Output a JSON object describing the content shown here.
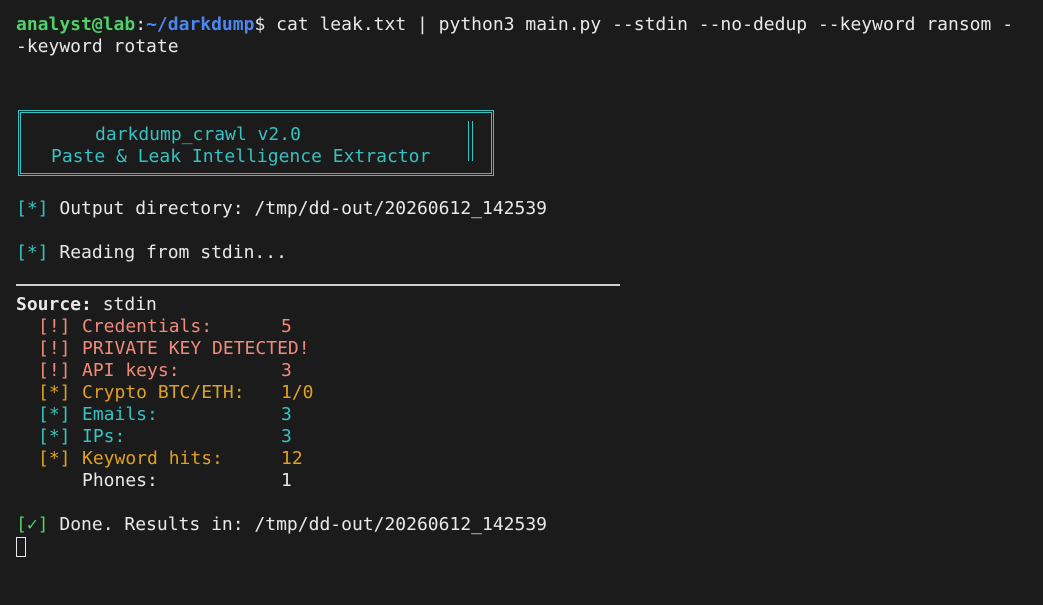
{
  "prompt": {
    "user_host": "analyst@lab",
    "separator": ":",
    "path": "~/darkdump",
    "symbol": "$",
    "command_line1": " cat leak.txt | python3 main.py --stdin --no-dedup --keyword ransom -",
    "command_line2": "-keyword rotate"
  },
  "banner": {
    "title": "darkdump_crawl v2.0",
    "subtitle": "Paste & Leak Intelligence Extractor"
  },
  "messages": {
    "output_dir_tag": "[*]",
    "output_dir": " Output directory: /tmp/dd-out/20260612_142539",
    "reading_tag": "[*]",
    "reading": " Reading from stdin..."
  },
  "source": {
    "label": "Source:",
    "value": " stdin"
  },
  "stats": [
    {
      "tag": "[!]",
      "label": "Credentials:",
      "value": "5",
      "color": "#f08a7a"
    },
    {
      "tag": "[!]",
      "label": "PRIVATE KEY DETECTED!",
      "value": "",
      "color": "#f08a7a"
    },
    {
      "tag": "[!]",
      "label": "API keys:",
      "value": "3",
      "color": "#f08a7a"
    },
    {
      "tag": "[*]",
      "label": "Crypto BTC/ETH:",
      "value": "1/0",
      "color": "#e0a020"
    },
    {
      "tag": "[*]",
      "label": "Emails:",
      "value": "3",
      "color": "#35c2c2"
    },
    {
      "tag": "[*]",
      "label": "IPs:",
      "value": "3",
      "color": "#35c2c2"
    },
    {
      "tag": "[*]",
      "label": "Keyword hits:",
      "value": "12",
      "color": "#e0a020"
    },
    {
      "tag": "",
      "label": "Phones:",
      "value": "1",
      "color": "#e8e8e8"
    }
  ],
  "done": {
    "tag": "[✓]",
    "text": " Done. Results in: /tmp/dd-out/20260612_142539"
  },
  "colors": {
    "background": "#1b1b1b",
    "accent_cyan": "#35c2c2",
    "prompt_green": "#4fd06a",
    "path_blue": "#4c86f0"
  }
}
